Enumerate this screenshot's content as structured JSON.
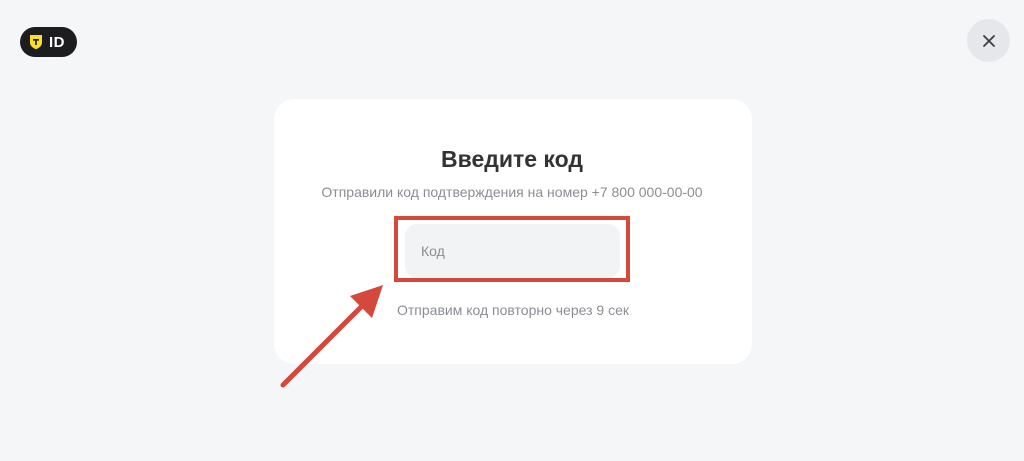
{
  "header": {
    "logo_text": "ID",
    "logo_icon": "shield-icon",
    "close_icon": "close-icon"
  },
  "form": {
    "title": "Введите код",
    "subtitle": "Отправили код подтверждения на номер +7 800 000-00-00",
    "code_placeholder": "Код",
    "code_value": "",
    "resend_text": "Отправим код повторно через 9 сек"
  },
  "annotation": {
    "icon": "arrow-icon",
    "highlight_color": "#d4493b"
  },
  "colors": {
    "background": "#f5f6f8",
    "card": "#ffffff",
    "logo_background": "#1d1d1f",
    "logo_accent": "#ffdd2d",
    "title": "#333333",
    "muted_text": "#8a8d93",
    "input_background": "#f2f3f5",
    "close_button_background": "#e5e7eb"
  }
}
